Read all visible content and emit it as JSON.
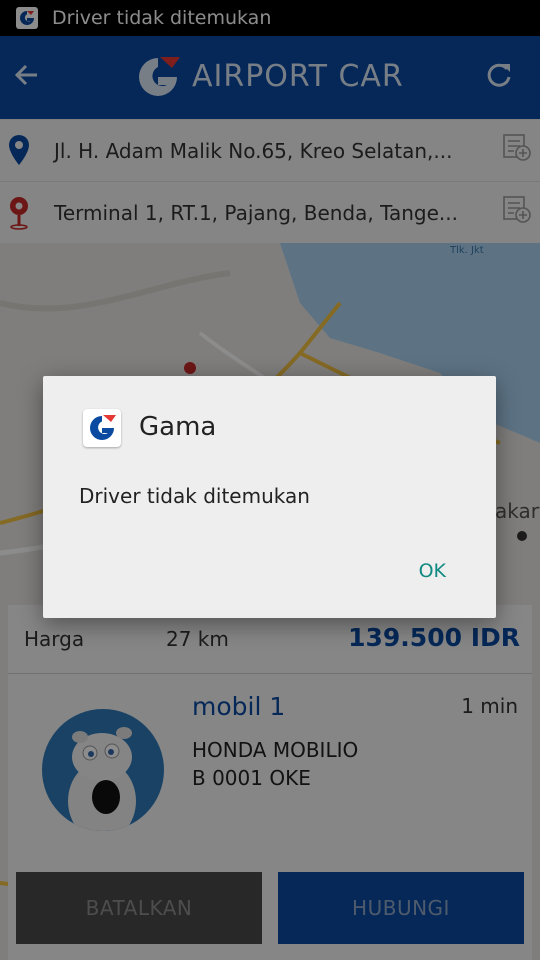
{
  "status_bar": {
    "notification_text": "Driver tidak ditemukan"
  },
  "app_bar": {
    "title": "AIRPORT CAR"
  },
  "pickup": {
    "address": "Jl. H. Adam Malik No.65, Kreo Selatan,..."
  },
  "destination": {
    "address": "Terminal 1, RT.1, Pajang, Benda, Tange..."
  },
  "map": {
    "labels": [
      "Tlk. Jkt",
      "akart"
    ]
  },
  "trip": {
    "price_label": "Harga",
    "distance": "27 km",
    "price": "139.500 IDR"
  },
  "driver": {
    "car_name": "mobil 1",
    "eta": "1 min",
    "model": "HONDA MOBILIO",
    "plate": "B 0001 OKE"
  },
  "actions": {
    "cancel_label": "BATALKAN",
    "call_label": "HUBUNGI"
  },
  "dialog": {
    "app_name": "Gama",
    "message": "Driver tidak ditemukan",
    "ok_label": "OK"
  },
  "colors": {
    "primary": "#0a4aa0",
    "pickup_pin": "#0a4aa0",
    "destination_pin": "#c62828",
    "dialog_ok": "#118a82"
  }
}
